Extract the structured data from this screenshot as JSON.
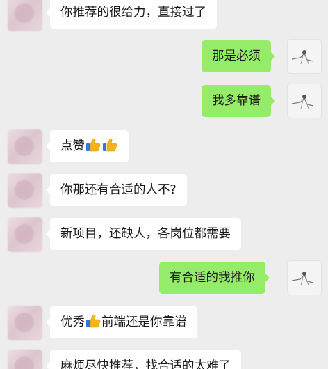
{
  "messages": [
    {
      "side": "left",
      "text": "你推荐的很给力，直接过了"
    },
    {
      "side": "right",
      "text": "那是必须"
    },
    {
      "side": "right",
      "text": "我多靠谱"
    },
    {
      "side": "left",
      "text_before": "点赞",
      "emojis": [
        "thumbs-up-icon",
        "thumbs-up-icon"
      ]
    },
    {
      "side": "left",
      "text": "你那还有合适的人不?"
    },
    {
      "side": "left",
      "text": "新项目，还缺人，各岗位都需要"
    },
    {
      "side": "right",
      "text": "有合适的我推你"
    },
    {
      "side": "left",
      "text_before": "优秀",
      "emojis": [
        "thumbs-up-icon"
      ],
      "text_after": "前端还是你靠谱"
    },
    {
      "side": "left",
      "text": "麻烦尽快推荐，找合适的太难了"
    }
  ],
  "colors": {
    "background": "#ededed",
    "bubble_received": "#ffffff",
    "bubble_sent": "#95ec69",
    "text": "#191919"
  }
}
